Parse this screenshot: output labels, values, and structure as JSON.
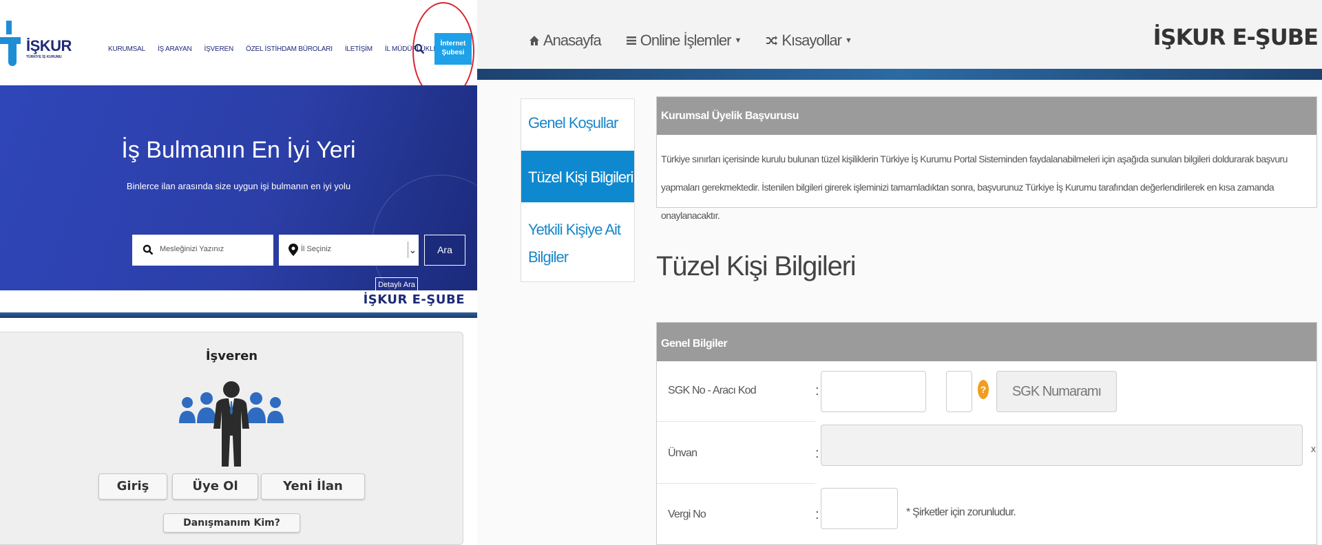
{
  "left": {
    "logo": {
      "text": "İŞKUR",
      "sub": "TÜRKİYE İŞ KURUMU"
    },
    "nav": [
      "KURUMSAL",
      "İŞ ARAYAN",
      "İŞVEREN",
      "ÖZEL İSTİHDAM BÜROLARI",
      "İLETİŞİM",
      "İL MÜDÜRLÜKLERİ"
    ],
    "internet_button": "İnternet Şubesi",
    "hero": {
      "title": "İş Bulmanın En İyi Yeri",
      "subtitle": "Binlerce ilan arasında size uygun işi bulmanın en iyi yolu",
      "job_placeholder": "Mesleğinizi Yazınız",
      "city_placeholder": "İl Seçiniz",
      "search_label": "Ara",
      "advanced_label": "Detaylı Ara"
    },
    "eshube": "İŞKUR E-ŞUBE",
    "card": {
      "title": "İşveren",
      "login": "Giriş",
      "register": "Üye Ol",
      "new_ad": "Yeni İlan",
      "advisor": "Danışmanım Kim?"
    }
  },
  "right": {
    "nav": {
      "home": "Anasayfa",
      "online": "Online İşlemler",
      "shortcuts": "Kısayollar"
    },
    "brand": "İŞKUR E-ŞUBE",
    "side": {
      "item1": "Genel Koşullar",
      "item2": "Tüzel Kişi Bilgileri",
      "item3": "Yetkili Kişiye Ait Bilgiler"
    },
    "info": {
      "header": "Kurumsal Üyelik Başvurusu",
      "body": "Türkiye sınırları içerisinde kurulu bulunan tüzel kişiliklerin Türkiye İş Kurumu Portal Sisteminden faydalanabilmeleri için aşağıda sunulan bilgileri doldurarak başvuru yapmaları gerekmektedir. İstenilen bilgileri girerek işleminizi tamamladıktan sonra, başvurunuz Türkiye İş Kurumu tarafından değerlendirilerek en kısa zamanda onaylanacaktır."
    },
    "page_title": "Tüzel Kişi Bilgileri",
    "form": {
      "header": "Genel Bilgiler",
      "sgk_label": "SGK No - Aracı Kod",
      "verify_label": "SGK Numaramı Doğrula",
      "unvan_label": "Ünvan",
      "vergi_label": "Vergi No",
      "vergi_note": "* Şirketler için zorunludur.",
      "colon": ":",
      "x": "x"
    }
  }
}
